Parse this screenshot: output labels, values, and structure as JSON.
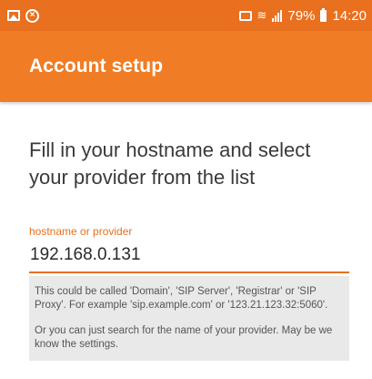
{
  "status_bar": {
    "battery": "79%",
    "time": "14:20",
    "left_icons": [
      "image-icon",
      "blocked-circle-icon"
    ],
    "right_icons": [
      "cast-icon",
      "wifi-icon",
      "signal-icon",
      "battery-icon"
    ]
  },
  "app_bar": {
    "title": "Account setup",
    "color": "#f07c25"
  },
  "main": {
    "prompt": "Fill in your hostname and select your provider from the list",
    "field": {
      "label": "hostname or provider",
      "value": "192.168.0.131"
    },
    "help": {
      "paragraph1": "This could be called 'Domain', 'SIP Server', 'Registrar' or 'SIP Proxy'. For example 'sip.example.com' or '123.21.123.32:5060'.",
      "paragraph2": "Or you can just search for the name of your provider. May be we know the settings."
    }
  },
  "colors": {
    "accent": "#e8701f",
    "help_background": "#e9e9e9"
  }
}
